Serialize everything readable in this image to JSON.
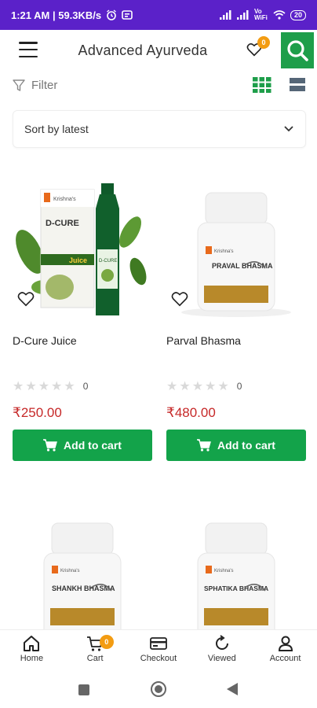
{
  "status_bar": {
    "time_speed": "1:21 AM | 59.3KB/s",
    "network_label": "Vo WiFi",
    "battery": "20"
  },
  "app_bar": {
    "title": "Advanced Ayurveda",
    "wishlist_count": "0"
  },
  "toolbar": {
    "filter_label": "Filter"
  },
  "sort": {
    "selected": "Sort by latest"
  },
  "products": [
    {
      "name": "D-Cure Juice",
      "price": "₹250.00",
      "rating_count": "0",
      "cart_label": "Add to cart",
      "brand": "Krishna's",
      "pack_label": "D-CURE",
      "pack_sub": "Juice"
    },
    {
      "name": "Parval Bhasma",
      "price": "₹480.00",
      "rating_count": "0",
      "cart_label": "Add to cart",
      "brand": "Krishna's",
      "pack_label": "PRAVAL BHASMA"
    },
    {
      "name": "",
      "brand": "Krishna's",
      "pack_label": "SHANKH BHASMA"
    },
    {
      "name": "",
      "brand": "Krishna's",
      "pack_label": "SPHATIKA BHASMA"
    }
  ],
  "bottom_nav": {
    "home": "Home",
    "cart": "Cart",
    "cart_count": "0",
    "checkout": "Checkout",
    "viewed": "Viewed",
    "account": "Account"
  },
  "colors": {
    "status_bar": "#5b21c9",
    "accent_green": "#13a34a",
    "price_red": "#c62828",
    "badge_orange": "#f39c12"
  }
}
